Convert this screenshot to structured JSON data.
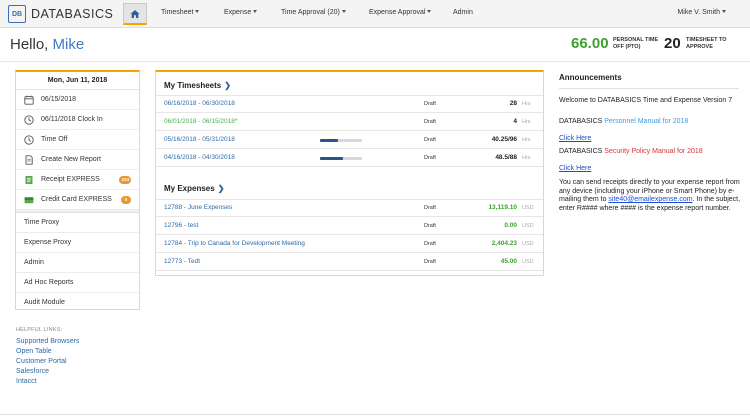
{
  "app": {
    "logo_mark": "DB",
    "logo_text": "DATABASICS"
  },
  "nav": {
    "items": [
      {
        "label": "Timesheet",
        "has_caret": true
      },
      {
        "label": "Expense",
        "has_caret": true
      },
      {
        "label": "Time Approval (20)",
        "has_caret": true
      },
      {
        "label": "Expense Approval",
        "has_caret": true
      },
      {
        "label": "Admin",
        "has_caret": false
      }
    ],
    "user": "Mike V. Smith"
  },
  "header": {
    "greeting": "Hello,",
    "name": "Mike",
    "pto_value": "66.00",
    "pto_label": "PERSONAL TIME OFF (PTO)",
    "approve_value": "20",
    "approve_label": "TIMESHEET TO APPROVE"
  },
  "left": {
    "date": "Mon, Jun 11, 2018",
    "items": [
      {
        "icon": "calendar-icon",
        "label": "06/15/2018"
      },
      {
        "icon": "clock-icon",
        "label": "06/11/2018 Clock In"
      },
      {
        "icon": "clock-icon",
        "label": "Time Off"
      },
      {
        "icon": "document-icon",
        "label": "Create New Report"
      },
      {
        "icon": "receipt-icon",
        "label": "Receipt EXPRESS",
        "badge": "104"
      },
      {
        "icon": "credit-card-icon",
        "label": "Credit Card EXPRESS",
        "badge": "0"
      }
    ],
    "plain_items": [
      "Time Proxy",
      "Expense Proxy",
      "Admin",
      "Ad Hoc Reports",
      "Audit Module"
    ]
  },
  "helpful": {
    "title": "HELPFUL LINKS:",
    "links": [
      "Supported Browsers",
      "Open Table",
      "Customer Portal",
      "Salesforce",
      "Intacct"
    ]
  },
  "timesheets": {
    "title": "My Timesheets",
    "rows": [
      {
        "period": "06/16/2018 - 06/30/2018",
        "status": "Draft",
        "value": "28",
        "unit": "Hrs",
        "progress": null,
        "green": false
      },
      {
        "period": "06/01/2018 - 06/15/2018*",
        "status": "Draft",
        "value": "4",
        "unit": "Hrs",
        "progress": null,
        "green": true
      },
      {
        "period": "05/16/2018 - 05/31/2018",
        "status": "Draft",
        "value": "40.25/96",
        "unit": "Hrs",
        "progress": 0.42,
        "green": false
      },
      {
        "period": "04/16/2018 - 04/30/2018",
        "status": "Draft",
        "value": "48.5/88",
        "unit": "Hrs",
        "progress": 0.55,
        "green": false
      }
    ]
  },
  "expenses": {
    "title": "My Expenses",
    "rows": [
      {
        "name": "12788 - June Expenses",
        "status": "Draft",
        "amount": "13,119.10",
        "currency": "USD"
      },
      {
        "name": "12796 - test",
        "status": "Draft",
        "amount": "0.00",
        "currency": "USD"
      },
      {
        "name": "12784 - Trip to Canada for Development Meeting",
        "status": "Draft",
        "amount": "2,404.23",
        "currency": "USD"
      },
      {
        "name": "12773 - Tedt",
        "status": "Draft",
        "amount": "45.00",
        "currency": "USD"
      }
    ]
  },
  "announcements": {
    "title": "Announcements",
    "welcome": "Welcome to DATABASICS Time and Expense Version 7",
    "manual_prefix": "DATABASICS",
    "manual_name": "Personnel Manual for 2018",
    "click_here_1": "Click Here",
    "policy_prefix": "DATABASICS",
    "policy_name": "Security Policy Manual for 2018",
    "click_here_2": "Click Here",
    "receipts_text_1": "You can send receipts directly to your expense report from any device (including your iPhone or Smart Phone) by e-mailing them to",
    "email": "site40@emailexpense.com",
    "receipts_text_2": ". In the subject, enter R#### where #### is the expense report number."
  },
  "colors": {
    "accent": "#f2a800",
    "link": "#2d6aa8",
    "green": "#3ea12f",
    "brand": "#3a6fb4"
  }
}
